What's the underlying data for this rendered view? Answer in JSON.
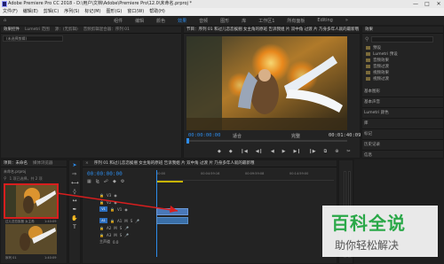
{
  "window": {
    "title": "Adobe Premiere Pro CC 2018 - D:\\用户\\文档\\Adobe\\Premiere Pro\\12.0\\未命名.prproj *",
    "controls": [
      "—",
      "□",
      "✕"
    ]
  },
  "menu": [
    "文件(F)",
    "编辑(E)",
    "剪辑(C)",
    "序列(S)",
    "标记(M)",
    "图形(G)",
    "窗口(W)",
    "帮助(H)"
  ],
  "workspaces": {
    "items": [
      "组件",
      "编辑",
      "颜色",
      "效果",
      "音频",
      "图形",
      "库",
      "工作区1",
      "所有面板",
      "Editing"
    ],
    "active_index": 3
  },
  "source_panel": {
    "tabs": [
      "效果控件",
      "Lumetri 范围",
      "源：(无剪辑)",
      "音频剪辑混合器：序列 01"
    ],
    "dropdown": "(未选择剪辑)"
  },
  "program_panel": {
    "tab": "节目：序列 01 和过儿恋恋挨捆 女主角的原班 告诉我姐 片 双中角 过渡 片 乃身多年人就的最新哦",
    "timecode_left": "00:00:00:00",
    "fit": "适合",
    "quality": "完整",
    "timecode_right": "00:01:40:09",
    "controls": [
      "◆",
      "◆",
      "❙◀",
      "◀❙",
      "◀",
      "▶",
      "▶❙",
      "❙▶",
      "⧉",
      "⊕",
      "✂"
    ]
  },
  "effects_panel": {
    "title": "效果",
    "items": [
      "预设",
      "Lumetri 预设",
      "音频效果",
      "音频过渡",
      "视频效果",
      "视频过渡"
    ],
    "sections": [
      "基本图形",
      "基本声音",
      "Lumetri 颜色",
      "库",
      "标记",
      "历史记录",
      "信息"
    ]
  },
  "project_panel": {
    "tabs": [
      "项目：未命名",
      "媒体浏览器"
    ],
    "file": "未命名.prproj",
    "count": "1 项已选择，共 2 项",
    "clips": [
      {
        "name": "过儿恋恋挨捆 女主角",
        "dur": "1:40:09"
      },
      {
        "name": "序列 01",
        "dur": "1:40:09"
      }
    ]
  },
  "timeline": {
    "tab": "序列 01 和过儿恋恋挨捆 女主角的原班 告诉我姐 片 双中角 过渡 片 乃身多年人就的最新哦",
    "timecode": "00:00:00:00",
    "ruler": [
      "00:00",
      "00:04:59:16",
      "00:09:59:08",
      "00:14:59:00"
    ],
    "tracks": [
      "V3",
      "V2",
      "V1",
      "A1",
      "A2",
      "A3"
    ],
    "master": "主声道",
    "master_value": "0.0"
  },
  "colors": {
    "accent": "#2d8ceb",
    "highlight_box": "#d81e1e",
    "audio_clip": "#3a6fa8",
    "video_clip": "#4a78b8"
  },
  "watermark": {
    "main": "百科全说",
    "sub": "助你轻松解决"
  }
}
